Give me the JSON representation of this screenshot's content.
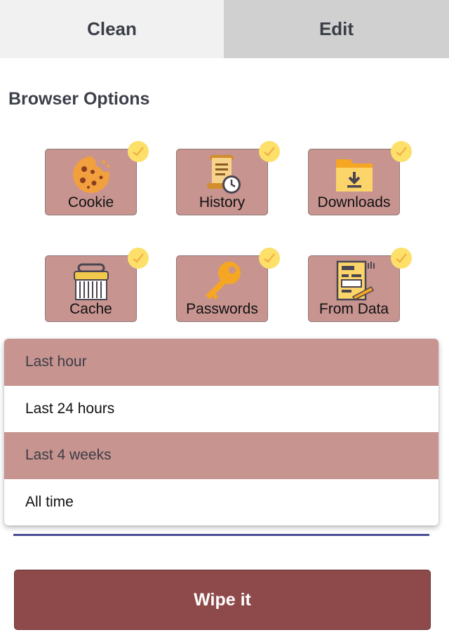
{
  "tabs": [
    {
      "label": "Clean",
      "active": true
    },
    {
      "label": "Edit",
      "active": false
    }
  ],
  "section_title": "Browser Options",
  "options": [
    {
      "label": "Cookie",
      "icon": "cookie-icon",
      "checked": true
    },
    {
      "label": "History",
      "icon": "history-scroll-icon",
      "checked": true
    },
    {
      "label": "Downloads",
      "icon": "downloads-folder-icon",
      "checked": true
    },
    {
      "label": "Cache",
      "icon": "brush-icon",
      "checked": true
    },
    {
      "label": "Passwords",
      "icon": "key-icon",
      "checked": true
    },
    {
      "label": "From Data",
      "icon": "form-document-icon",
      "checked": true
    }
  ],
  "time_range": {
    "options": [
      {
        "label": "Last hour",
        "highlighted": true
      },
      {
        "label": "Last 24 hours",
        "highlighted": false
      },
      {
        "label": "Last 4 weeks",
        "highlighted": true
      },
      {
        "label": "All time",
        "highlighted": false
      }
    ]
  },
  "wipe_button": {
    "label": "Wipe it"
  },
  "colors": {
    "accent": "#c79490",
    "button": "#8e4a4a",
    "check": "#fde06a",
    "underline": "#4a4e96"
  }
}
